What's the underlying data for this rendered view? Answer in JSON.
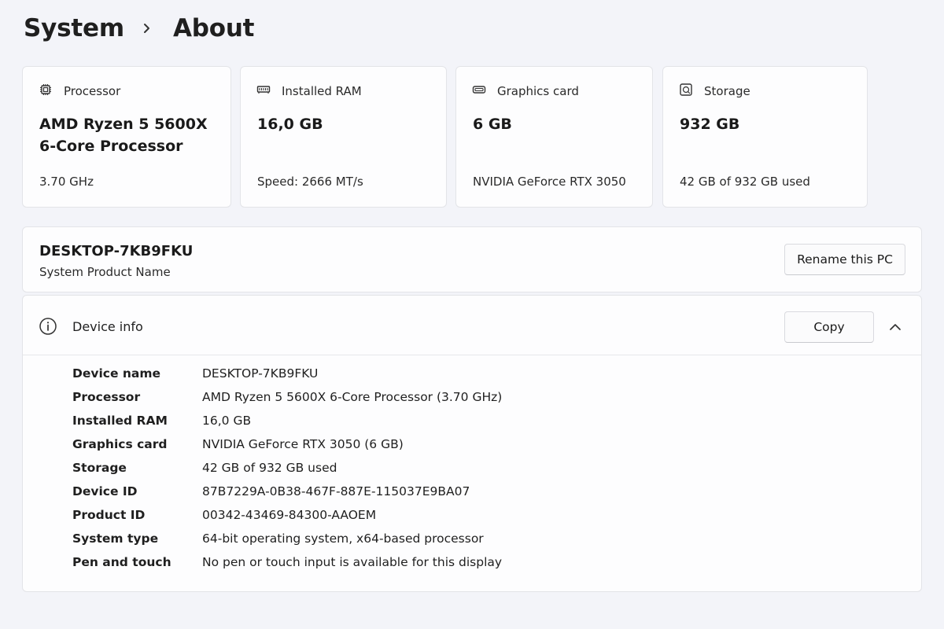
{
  "breadcrumb": {
    "parent": "System",
    "current": "About"
  },
  "cards": [
    {
      "label": "Processor",
      "icon": "processor-icon",
      "value": "AMD Ryzen 5 5600X 6-Core Processor",
      "sub": "3.70 GHz"
    },
    {
      "label": "Installed RAM",
      "icon": "ram-icon",
      "value": "16,0 GB",
      "sub": "Speed: 2666 MT/s"
    },
    {
      "label": "Graphics card",
      "icon": "graphics-card-icon",
      "value": "6 GB",
      "sub": "NVIDIA GeForce RTX 3050"
    },
    {
      "label": "Storage",
      "icon": "storage-icon",
      "value": "932 GB",
      "sub": "42 GB of 932 GB used"
    }
  ],
  "pc": {
    "name": "DESKTOP-7KB9FKU",
    "sub": "System Product Name",
    "rename_label": "Rename this PC"
  },
  "device_info": {
    "title": "Device info",
    "icon": "info-icon",
    "copy_label": "Copy",
    "rows": [
      {
        "key": "Device name",
        "value": "DESKTOP-7KB9FKU"
      },
      {
        "key": "Processor",
        "value": "AMD Ryzen 5 5600X 6-Core Processor (3.70 GHz)"
      },
      {
        "key": "Installed RAM",
        "value": "16,0 GB"
      },
      {
        "key": "Graphics card",
        "value": "NVIDIA GeForce RTX 3050 (6 GB)"
      },
      {
        "key": "Storage",
        "value": "42 GB of 932 GB used"
      },
      {
        "key": "Device ID",
        "value": "87B7229A-0B38-467F-887E-115037E9BA07"
      },
      {
        "key": "Product ID",
        "value": "00342-43469-84300-AAOEM"
      },
      {
        "key": "System type",
        "value": "64-bit operating system, x64-based processor"
      },
      {
        "key": "Pen and touch",
        "value": "No pen or touch input is available for this display"
      }
    ]
  }
}
